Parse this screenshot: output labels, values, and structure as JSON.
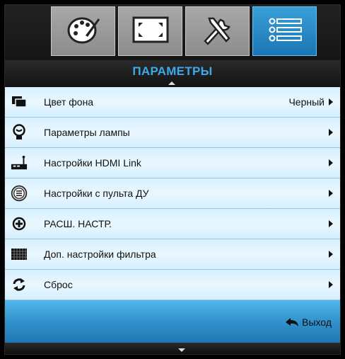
{
  "tabs": [
    {
      "icon": "palette-icon",
      "active": false
    },
    {
      "icon": "screen-resize-icon",
      "active": false
    },
    {
      "icon": "tools-icon",
      "active": false
    },
    {
      "icon": "options-list-icon",
      "active": true
    }
  ],
  "menu": {
    "title": "ПАРАМЕТРЫ",
    "items": [
      {
        "icon": "background-color-icon",
        "label": "Цвет фона",
        "value": "Черный"
      },
      {
        "icon": "lamp-icon",
        "label": "Параметры лампы",
        "value": ""
      },
      {
        "icon": "hdmi-link-icon",
        "label": "Настройки HDMI Link",
        "value": ""
      },
      {
        "icon": "remote-control-icon",
        "label": "Настройки с пульта ДУ",
        "value": ""
      },
      {
        "icon": "advanced-plus-icon",
        "label": "РАСШ. НАСТР.",
        "value": ""
      },
      {
        "icon": "filter-icon",
        "label": "Доп. настройки фильтра",
        "value": ""
      },
      {
        "icon": "reset-icon",
        "label": "Сброс",
        "value": ""
      }
    ]
  },
  "footer": {
    "exit_label": "Выход",
    "exit_icon": "back-arrow-icon"
  },
  "colors": {
    "accent": "#3ea9ea",
    "row_bg": "#e2f4ff",
    "footer": "#2f8fc9"
  }
}
